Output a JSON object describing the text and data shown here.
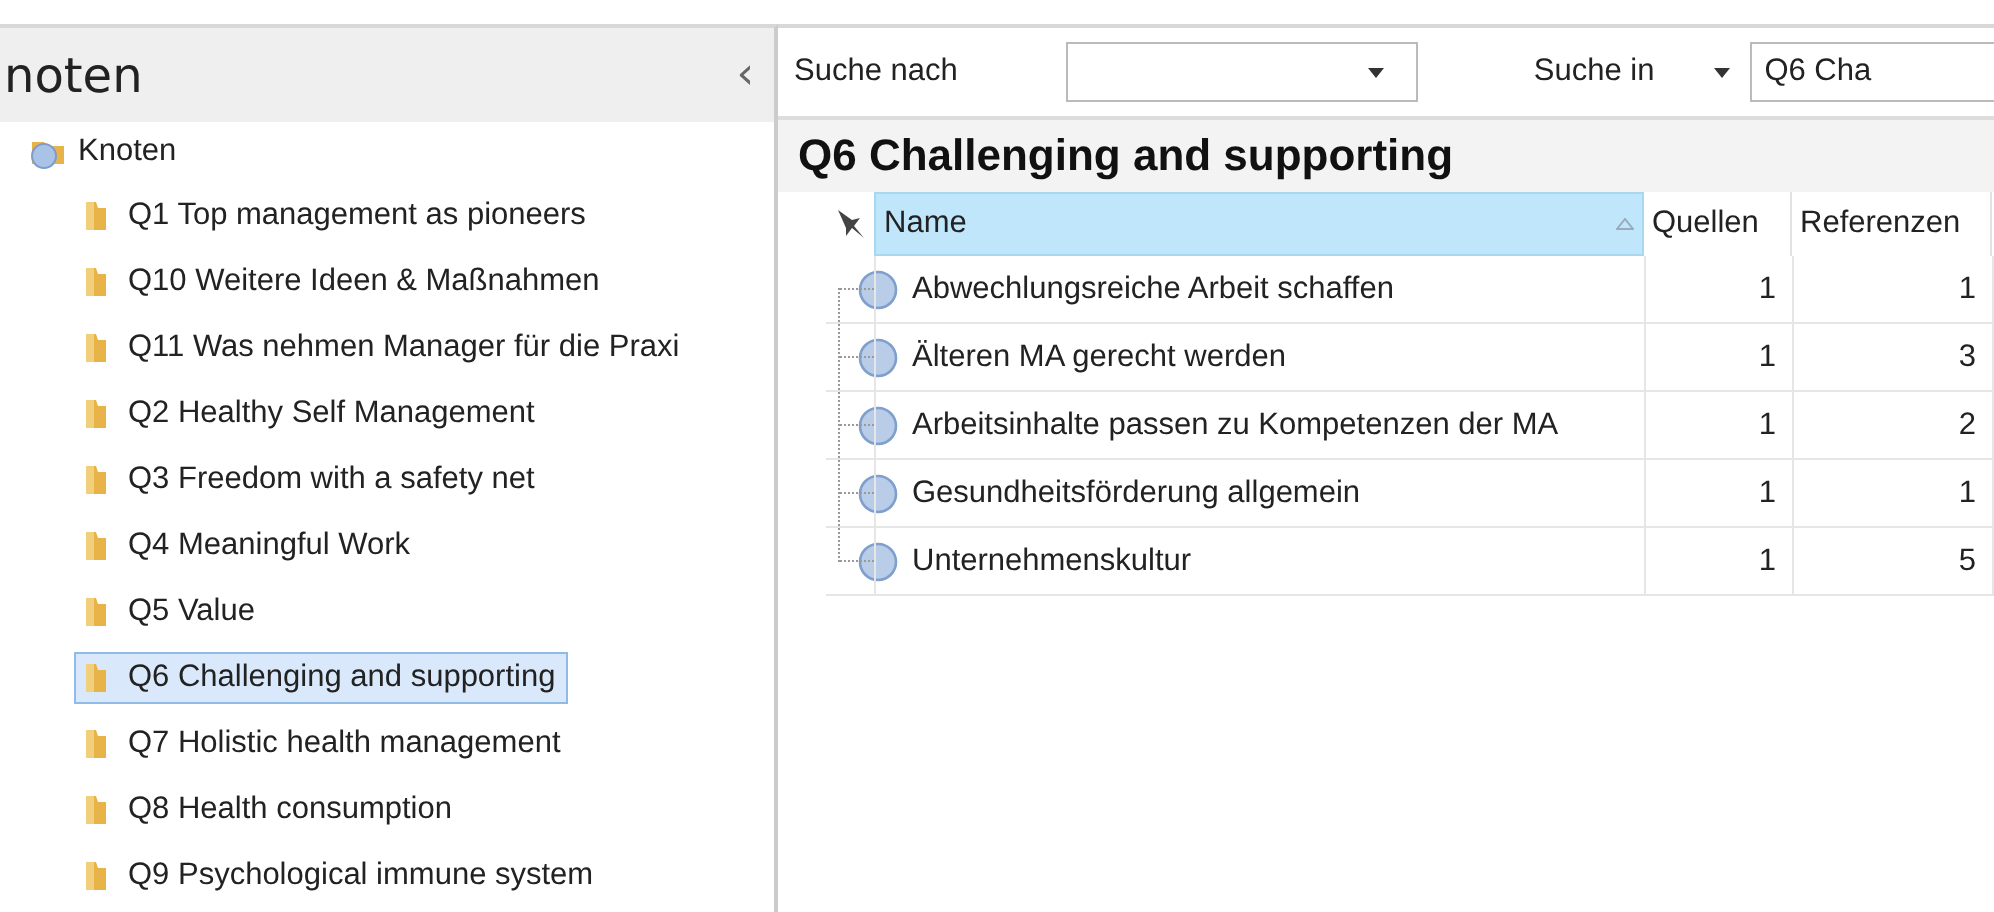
{
  "sidebar": {
    "title": "noten",
    "collapse_glyph": "‹",
    "tree": {
      "label": "Knoten",
      "children": [
        {
          "label": "Q1 Top management as pioneers",
          "selected": false
        },
        {
          "label": "Q10 Weitere Ideen & Maßnahmen",
          "selected": false
        },
        {
          "label": "Q11 Was nehmen Manager für die Praxi",
          "selected": false
        },
        {
          "label": "Q2 Healthy Self Management",
          "selected": false
        },
        {
          "label": "Q3 Freedom with a safety net",
          "selected": false
        },
        {
          "label": "Q4 Meaningful Work",
          "selected": false
        },
        {
          "label": "Q5 Value",
          "selected": false
        },
        {
          "label": "Q6 Challenging and supporting",
          "selected": true
        },
        {
          "label": "Q7 Holistic health management",
          "selected": false
        },
        {
          "label": "Q8 Health consumption",
          "selected": false
        },
        {
          "label": "Q9 Psychological immune system",
          "selected": false
        }
      ]
    }
  },
  "search_bar": {
    "search_for_label": "Suche nach",
    "search_in_label": "Suche in",
    "search_in_value": "Q6 Cha"
  },
  "detail": {
    "title": "Q6 Challenging and supporting",
    "table": {
      "columns": [
        {
          "label": "Name",
          "sorted": true
        },
        {
          "label": "Quellen",
          "sorted": false
        },
        {
          "label": "Referenzen",
          "sorted": false
        }
      ],
      "rows": [
        {
          "name": "Abwechlungsreiche Arbeit schaffen",
          "sources": "1",
          "references": "1"
        },
        {
          "name": "Älteren MA gerecht werden",
          "sources": "1",
          "references": "3"
        },
        {
          "name": "Arbeitsinhalte passen zu Kompetenzen der MA",
          "sources": "1",
          "references": "2"
        },
        {
          "name": "Gesundheitsförderung allgemein",
          "sources": "1",
          "references": "1"
        },
        {
          "name": "Unternehmenskultur",
          "sources": "1",
          "references": "5"
        }
      ]
    }
  }
}
